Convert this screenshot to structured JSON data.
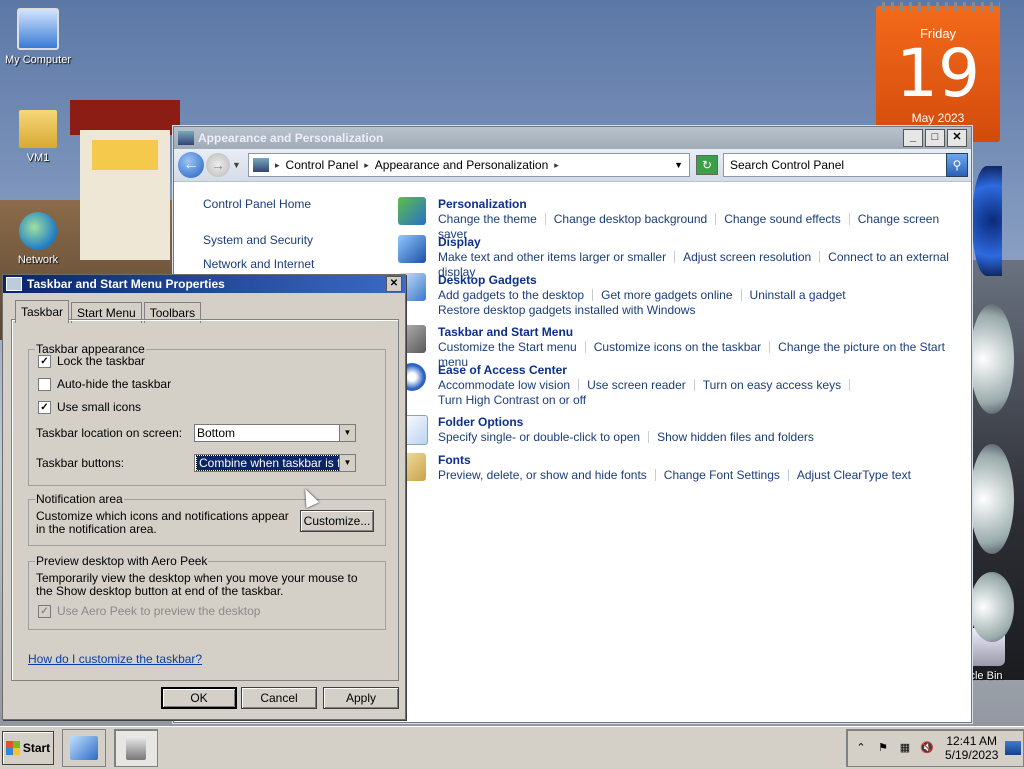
{
  "desktop": {
    "icons": [
      {
        "label": "My Computer",
        "icon": "computer-icon"
      },
      {
        "label": "VM1",
        "icon": "user-folder-icon"
      },
      {
        "label": "Network",
        "icon": "network-icon"
      },
      {
        "label": "cle Bin",
        "icon": "recycle-bin-icon"
      }
    ],
    "calendar_gadget": {
      "day": "Friday",
      "date": "19",
      "month": "May 2023"
    }
  },
  "control_panel": {
    "window_title": "Appearance and Personalization",
    "address": {
      "root": "Control Panel",
      "current": "Appearance and Personalization"
    },
    "search_placeholder": "Search Control Panel",
    "left_nav": [
      "Control Panel Home",
      "System and Security",
      "Network and Internet"
    ],
    "categories": [
      {
        "title": "Personalization",
        "icon": "personalization-icon",
        "links": [
          "Change the theme",
          "Change desktop background",
          "Change sound effects",
          "Change screen saver"
        ]
      },
      {
        "title": "Display",
        "icon": "display-icon",
        "links": [
          "Make text and other items larger or smaller",
          "Adjust screen resolution",
          "Connect to an external display"
        ]
      },
      {
        "title": "Desktop Gadgets",
        "icon": "gadgets-icon",
        "links": [
          "Add gadgets to the desktop",
          "Get more gadgets online",
          "Uninstall a gadget",
          "Restore desktop gadgets installed with Windows"
        ]
      },
      {
        "title": "Taskbar and Start Menu",
        "icon": "taskbar-icon",
        "links": [
          "Customize the Start menu",
          "Customize icons on the taskbar",
          "Change the picture on the Start menu"
        ]
      },
      {
        "title": "Ease of Access Center",
        "icon": "ease-of-access-icon",
        "links": [
          "Accommodate low vision",
          "Use screen reader",
          "Turn on easy access keys",
          "Turn High Contrast on or off"
        ]
      },
      {
        "title": "Folder Options",
        "icon": "folder-options-icon",
        "links": [
          "Specify single- or double-click to open",
          "Show hidden files and folders"
        ]
      },
      {
        "title": "Fonts",
        "icon": "fonts-icon",
        "links": [
          "Preview, delete, or show and hide fonts",
          "Change Font Settings",
          "Adjust ClearType text"
        ]
      }
    ]
  },
  "dialog": {
    "title": "Taskbar and Start Menu Properties",
    "tabs": [
      "Taskbar",
      "Start Menu",
      "Toolbars"
    ],
    "active_tab": "Taskbar",
    "appearance": {
      "legend": "Taskbar appearance",
      "lock": {
        "label": "Lock the taskbar",
        "checked": true
      },
      "autohide": {
        "label": "Auto-hide the taskbar",
        "checked": false
      },
      "small_icons": {
        "label": "Use small icons",
        "checked": true
      },
      "location_label": "Taskbar location on screen:",
      "location_value": "Bottom",
      "buttons_label": "Taskbar buttons:",
      "buttons_value": "Combine when taskbar is full"
    },
    "notification": {
      "legend": "Notification area",
      "text": "Customize which icons and notifications appear in the notification area.",
      "button": "Customize..."
    },
    "aero_peek": {
      "legend": "Preview desktop with Aero Peek",
      "text": "Temporarily view the desktop when you move your mouse to the Show desktop button at end of the taskbar.",
      "checkbox": "Use Aero Peek to preview the desktop",
      "checked": true,
      "disabled": true
    },
    "help_link": "How do I customize the taskbar?",
    "buttons": {
      "ok": "OK",
      "cancel": "Cancel",
      "apply": "Apply"
    }
  },
  "taskbar": {
    "start_label": "Start",
    "clock_time": "12:41 AM",
    "clock_date": "5/19/2023"
  }
}
